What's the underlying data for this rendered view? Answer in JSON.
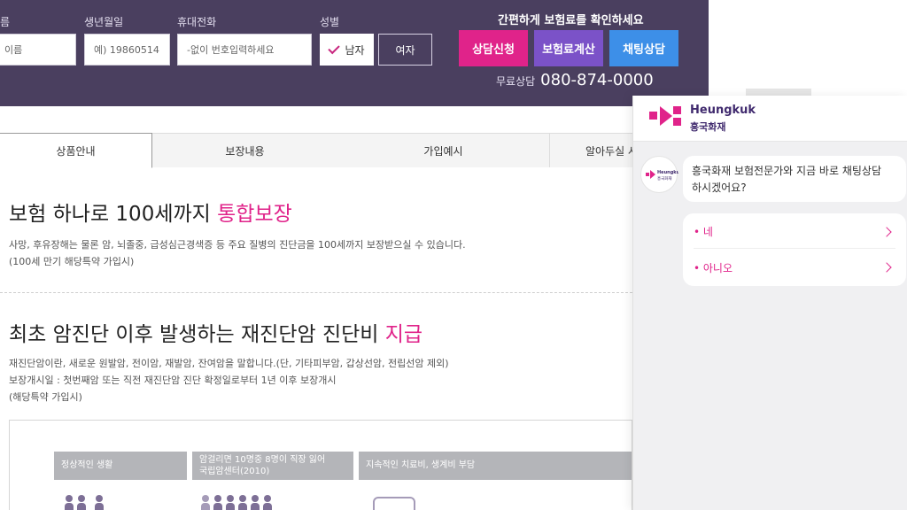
{
  "form": {
    "name_label": "름",
    "name_placeholder": "이름",
    "birth_label": "생년월일",
    "birth_placeholder": "예) 19860514",
    "phone_label": "휴대전화",
    "phone_placeholder": "-없이 번호입력하세요",
    "gender_label": "성별",
    "male_label": "남자",
    "female_label": "여자",
    "selected_gender": "남자"
  },
  "header": {
    "promo": "간편하게 보험료를 확인하세요",
    "buttons": [
      "상담신청",
      "보험료계산",
      "채팅상담"
    ],
    "phone_label": "무료상담",
    "phone_number": "080-874-0000"
  },
  "colors": {
    "accent_pink": "#e0238a",
    "accent_purple": "#7b52c8",
    "accent_blue": "#3d8fe8",
    "header_bg": "#4a3f5f",
    "brand": "#402a6e"
  },
  "tabs": [
    "상품안내",
    "보장내용",
    "가입예시",
    "알아두실 사"
  ],
  "sections": [
    {
      "title_plain": "보험 하나로 100세까지 ",
      "title_highlight": "통합보장",
      "lines": [
        "사망, 후유장해는 물론 암, 뇌졸중, 급성심근경색증 등 주요 질병의 진단금을 100세까지 보장받으실 수 있습니다.",
        "(100세 만기 해당특약 가입시)"
      ]
    },
    {
      "title_plain": "최초 암진단 이후 발생하는 재진단암 진단비 ",
      "title_highlight": "지급",
      "lines": [
        "재진단암이란, 새로운 원발암, 전이암, 재발암, 잔여암을 말합니다.(단, 기타피부암, 갑상선암, 전립선암 제외)",
        "보장개시일 : 첫번째암 또는 직전 재진단암 진단 확정일로부터 1년 이후 보장개시",
        "(해당특약 가입시)"
      ]
    }
  ],
  "diagram": {
    "stages": [
      [
        "정상적인 생활"
      ],
      [
        "암걸리면 10명중 8명이 직장 잃어",
        "국립암센터(2010)"
      ],
      [
        "지속적인 치료비, 생계비 부담"
      ]
    ],
    "icons": [
      "people-pair-icon",
      "people-group-icon",
      "caregiver-icon"
    ]
  },
  "chat": {
    "brand_en": "Heungkuk",
    "brand_ko": "흥국화재",
    "avatar_icon": "heungkuk-logo-icon",
    "message_lines": [
      "흥국화재 보험전문가와 지금 바로 채팅상담",
      "하시겠어요?"
    ],
    "options": [
      "• 네",
      "• 아니오"
    ]
  }
}
